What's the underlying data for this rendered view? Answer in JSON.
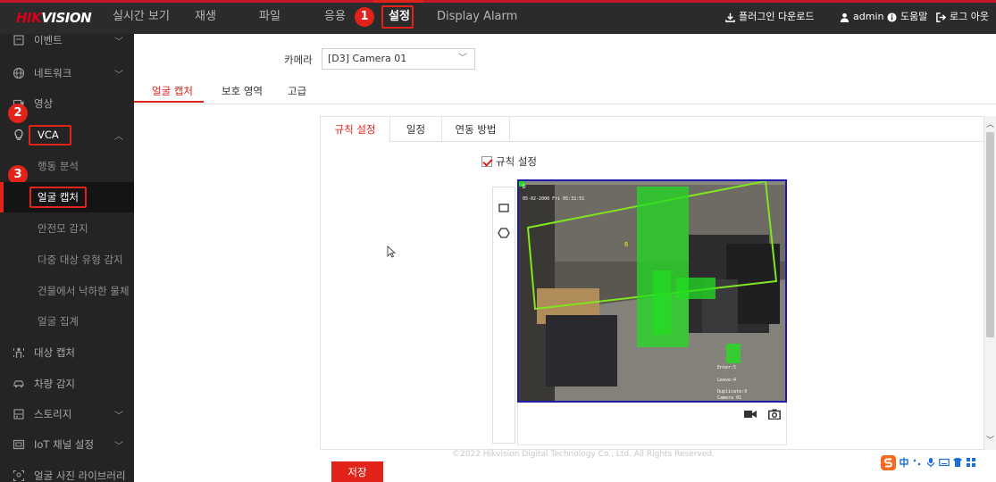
{
  "header": {
    "logo_hik": "HIK",
    "logo_vision": "VISION",
    "nav": [
      {
        "label": "실시간 보기"
      },
      {
        "label": "재생"
      },
      {
        "label": "파일"
      },
      {
        "label": "응용"
      },
      {
        "label": "설정",
        "active": true
      },
      {
        "label": "Display Alarm"
      }
    ],
    "plugin_download": "플러그인 다운로드",
    "user": "admin",
    "help": "도움말",
    "logout": "로그 아웃"
  },
  "annotations": [
    "1",
    "2",
    "3"
  ],
  "sidebar": {
    "items": [
      {
        "label": "이벤트",
        "icon": "event-icon"
      },
      {
        "label": "네트워크",
        "icon": "globe-icon"
      },
      {
        "label": "영상",
        "icon": "video-icon"
      },
      {
        "label": "VCA",
        "icon": "bulb-icon"
      },
      {
        "label": "대상 캡처",
        "icon": "person-icon"
      },
      {
        "label": "차량 감지",
        "icon": "car-icon"
      },
      {
        "label": "스토리지",
        "icon": "storage-icon"
      },
      {
        "label": "IoT 채널 설정",
        "icon": "iot-icon"
      },
      {
        "label": "얼굴 사진 라이브러리",
        "icon": "face-library-icon"
      }
    ],
    "vca_sub": [
      {
        "label": "행동 분석"
      },
      {
        "label": "얼굴 캡처",
        "active": true
      },
      {
        "label": "안전모 감지"
      },
      {
        "label": "다중 대상 유형 감지"
      },
      {
        "label": "건물에서 낙하한 물체"
      },
      {
        "label": "얼굴 집계"
      }
    ]
  },
  "camera": {
    "label": "카메라",
    "value": "[D3] Camera 01"
  },
  "tabs": [
    "얼굴 캡처",
    "보호 영역",
    "고급"
  ],
  "subtabs": [
    "규칙 설정",
    "일정",
    "연동 방법"
  ],
  "rule_checkbox": {
    "label": "규칙 설정",
    "checked": true
  },
  "video": {
    "timestamp": "05-02-2000 Fri 05:31:51",
    "corner": "D",
    "overlay": [
      "Enter:5",
      "Leave:4",
      "Duplicate:9",
      "Camera 01"
    ],
    "target_id": "6"
  },
  "save_label": "저장",
  "footer": "©2022 Hikvision Digital Technology Co., Ltd. All Rights Reserved.",
  "colors": {
    "accent": "#e2231a",
    "topbar": "#2b2b2b",
    "sidebar": "#242424",
    "detection": "#22dd22",
    "region": "#7fe620"
  }
}
